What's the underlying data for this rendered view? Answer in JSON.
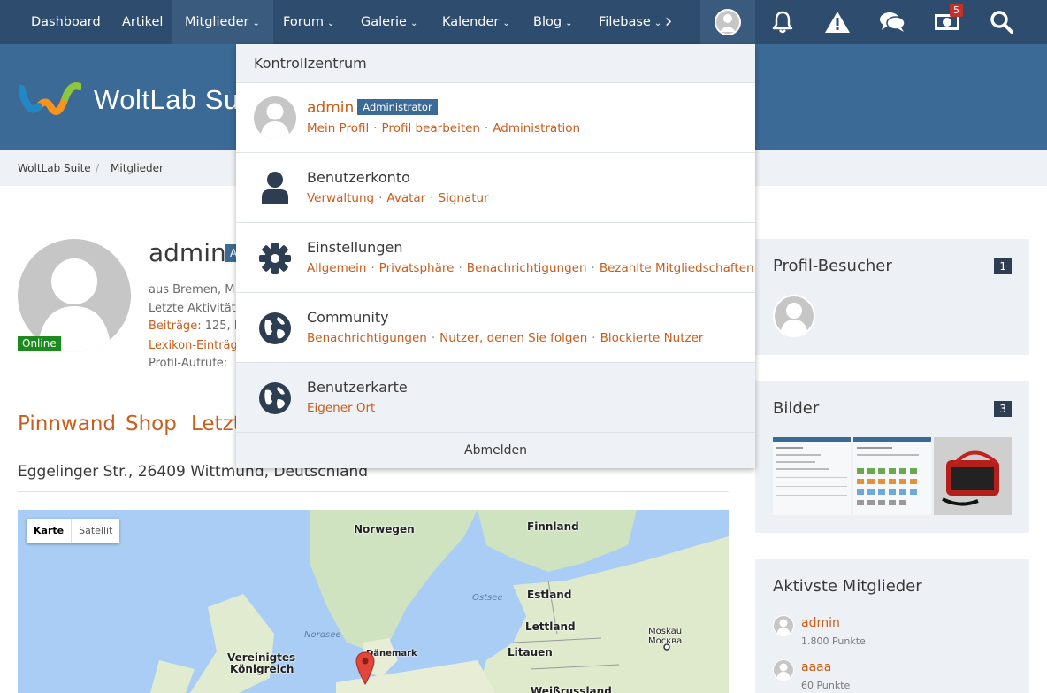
{
  "nav": {
    "items": [
      {
        "label": "Dashboard",
        "chevron": false
      },
      {
        "label": "Artikel",
        "chevron": false
      },
      {
        "label": "Mitglieder",
        "chevron": true
      },
      {
        "label": "Forum",
        "chevron": true
      },
      {
        "label": "Galerie",
        "chevron": true
      },
      {
        "label": "Kalender",
        "chevron": true
      },
      {
        "label": "Blog",
        "chevron": true
      },
      {
        "label": "Filebase",
        "chevron": true
      }
    ],
    "more_icon": "chevron-right-icon",
    "notification_count": "5"
  },
  "header": {
    "logo_text": "WoltLab Su"
  },
  "breadcrumb": {
    "items": [
      "WoltLab Suite",
      "Mitglieder"
    ],
    "separator": "/"
  },
  "profile": {
    "name": "admin",
    "tag": "A",
    "status": "Online",
    "meta": {
      "line1": "aus Bremen, M",
      "line2": "Letzte Aktivität:",
      "line3_link": "Beiträge",
      "line3_text": ": 125, ",
      "line3_trail": "E",
      "line4_link": "Lexikon-Einträg",
      "line5": "Profil-Aufrufe: "
    },
    "tabs": [
      "Pinnwand",
      "Shop",
      "Letzt"
    ],
    "address": "Eggelinger Str., 26409 Wittmund, Deutschland"
  },
  "map": {
    "type_buttons": [
      "Karte",
      "Satellit"
    ],
    "labels": {
      "norwegen": "Norwegen",
      "finnland": "Finnland",
      "ostsee": "Ostsee",
      "estland": "Estland",
      "moskau": "Moskau",
      "moskva": "Москва",
      "nordsee": "Nordsee",
      "daenemark": "Dänemark",
      "lettland": "Lettland",
      "litauen": "Litauen",
      "uk1": "Vereinigtes",
      "uk2": "Königreich",
      "weissrussland": "Weißrussland"
    }
  },
  "sidebar": {
    "visitors": {
      "title": "Profil-Besucher",
      "count": "1"
    },
    "images": {
      "title": "Bilder",
      "count": "3"
    },
    "active": {
      "title": "Aktivste Mitglieder",
      "members": [
        {
          "name": "admin",
          "points": "1.800 Punkte"
        },
        {
          "name": "aaaa",
          "points": "60 Punkte"
        }
      ]
    }
  },
  "dropdown": {
    "title": "Kontrollzentrum",
    "user": {
      "name": "admin",
      "role": "Administrator",
      "links": [
        "Mein Profil",
        "Profil bearbeiten",
        "Administration"
      ]
    },
    "sections": [
      {
        "title": "Benutzerkonto",
        "icon": "user-icon",
        "links": [
          "Verwaltung",
          "Avatar",
          "Signatur"
        ]
      },
      {
        "title": "Einstellungen",
        "icon": "gear-icon",
        "links": [
          "Allgemein",
          "Privatsphäre",
          "Benachrichtigungen",
          "Bezahlte Mitgliedschaften"
        ]
      },
      {
        "title": "Community",
        "icon": "globe-icon",
        "links": [
          "Benachrichtigungen",
          "Nutzer, denen Sie folgen",
          "Blockierte Nutzer"
        ]
      },
      {
        "title": "Benutzerkarte",
        "icon": "globe-icon",
        "links": [
          "Eigener Ort"
        ]
      }
    ],
    "logout": "Abmelden"
  }
}
